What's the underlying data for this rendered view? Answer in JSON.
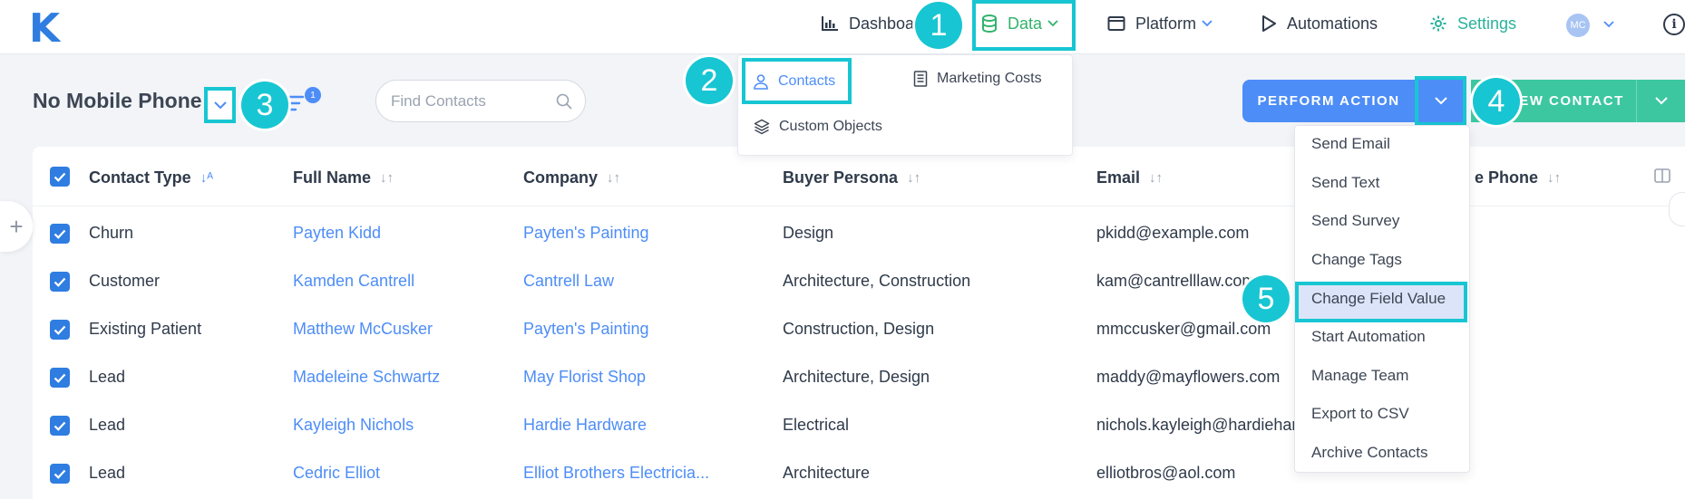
{
  "logo": "K",
  "nav": {
    "dashboard": "Dashboa",
    "data": "Data",
    "platform": "Platform",
    "automations": "Automations",
    "settings": "Settings",
    "avatar": "MC",
    "info": "i"
  },
  "view": {
    "title": "No Mobile Phone",
    "filter_count": "1"
  },
  "search": {
    "placeholder": "Find Contacts"
  },
  "buttons": {
    "perform_action": "PERFORM ACTION",
    "new_contact": "EW CONTACT"
  },
  "data_menu": {
    "contacts": "Contacts",
    "marketing_costs": "Marketing Costs",
    "custom_objects": "Custom Objects"
  },
  "table": {
    "headers": [
      "Contact Type",
      "Full Name",
      "Company",
      "Buyer Persona",
      "Email",
      "e Phone"
    ],
    "rows": [
      {
        "type": "Churn",
        "name": "Payten Kidd",
        "company": "Payten's Painting",
        "persona": "Design",
        "email": "pkidd@example.com"
      },
      {
        "type": "Customer",
        "name": "Kamden Cantrell",
        "company": "Cantrell Law",
        "persona": "Architecture, Construction",
        "email": "kam@cantrelllaw.com"
      },
      {
        "type": "Existing Patient",
        "name": "Matthew McCusker",
        "company": "Payten's Painting",
        "persona": "Construction, Design",
        "email": "mmccusker@gmail.com"
      },
      {
        "type": "Lead",
        "name": "Madeleine Schwartz",
        "company": "May Florist Shop",
        "persona": "Architecture, Design",
        "email": "maddy@mayflowers.com"
      },
      {
        "type": "Lead",
        "name": "Kayleigh Nichols",
        "company": "Hardie Hardware",
        "persona": "Electrical",
        "email": "nichols.kayleigh@hardiehar"
      },
      {
        "type": "Lead",
        "name": "Cedric Elliot",
        "company": "Elliot Brothers Electricia...",
        "persona": "Architecture",
        "email": "elliotbros@aol.com"
      }
    ]
  },
  "action_menu": [
    "Send Email",
    "Send Text",
    "Send Survey",
    "Change Tags",
    "Change Field Value",
    "Start Automation",
    "Manage Team",
    "Export to CSV",
    "Archive Contacts"
  ],
  "steps": [
    "1",
    "2",
    "3",
    "4",
    "5"
  ],
  "colors": {
    "accent": "#4d8df7",
    "highlight": "#17c6d2",
    "data_nav": "#32b36b",
    "new_contact": "#3dc7a1"
  }
}
